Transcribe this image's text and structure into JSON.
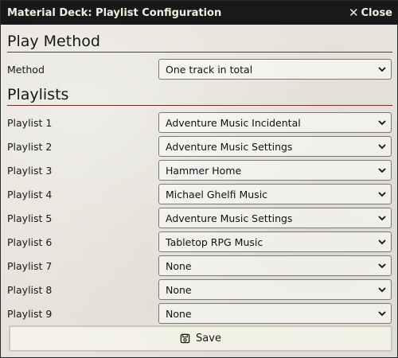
{
  "window": {
    "title": "Material Deck: Playlist Configuration",
    "close_label": "Close"
  },
  "play_method": {
    "heading": "Play Method",
    "method_label": "Method",
    "method_value": "One track in total"
  },
  "playlists": {
    "heading": "Playlists",
    "items": [
      {
        "label": "Playlist 1",
        "value": "Adventure Music Incidental"
      },
      {
        "label": "Playlist 2",
        "value": "Adventure Music Settings"
      },
      {
        "label": "Playlist 3",
        "value": "Hammer Home"
      },
      {
        "label": "Playlist 4",
        "value": "Michael Ghelfi Music"
      },
      {
        "label": "Playlist 5",
        "value": "Adventure Music Settings"
      },
      {
        "label": "Playlist 6",
        "value": "Tabletop RPG Music"
      },
      {
        "label": "Playlist 7",
        "value": "None"
      },
      {
        "label": "Playlist 8",
        "value": "None"
      },
      {
        "label": "Playlist 9",
        "value": "None"
      }
    ]
  },
  "footer": {
    "save_label": "Save",
    "save_icon": "save-icon"
  },
  "colors": {
    "titlebar": "#191919",
    "accent_rule": "#782e22",
    "background": "#e6e3db"
  }
}
